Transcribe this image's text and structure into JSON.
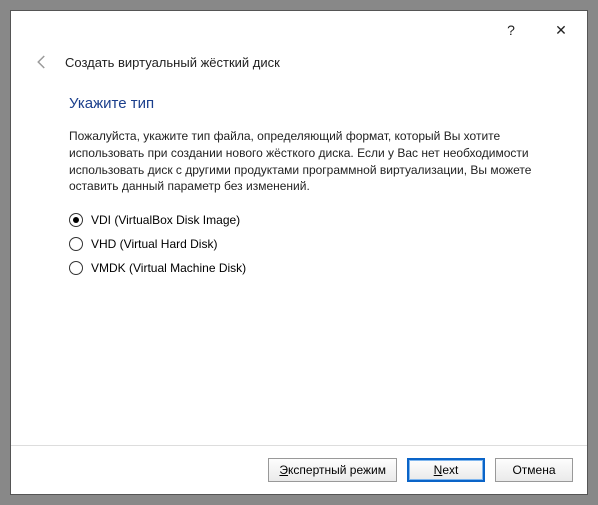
{
  "titlebar": {
    "help": "?",
    "close": "✕"
  },
  "header": {
    "wizard_title": "Создать виртуальный жёсткий диск"
  },
  "content": {
    "section_title": "Укажите тип",
    "description": "Пожалуйста, укажите тип файла, определяющий формат, который Вы хотите использовать при создании нового жёсткого диска. Если у Вас нет необходимости использовать диск с другими продуктами программной виртуализации, Вы можете оставить данный параметр без изменений.",
    "options": [
      {
        "label": "VDI (VirtualBox Disk Image)",
        "selected": true
      },
      {
        "label": "VHD (Virtual Hard Disk)",
        "selected": false
      },
      {
        "label": "VMDK (Virtual Machine Disk)",
        "selected": false
      }
    ]
  },
  "footer": {
    "expert_mnemonic": "Э",
    "expert_rest": "кспертный режим",
    "next_mnemonic": "N",
    "next_rest": "ext",
    "cancel": "Отмена"
  }
}
